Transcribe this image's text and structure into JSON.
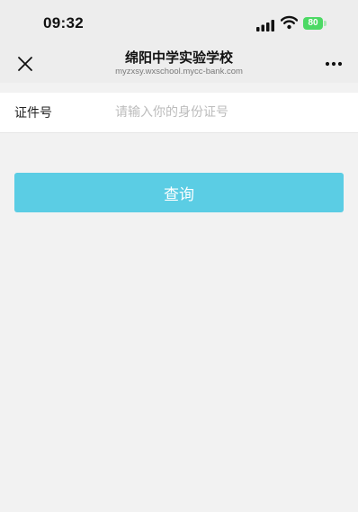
{
  "status_bar": {
    "time": "09:32",
    "battery": "80"
  },
  "nav": {
    "title": "绵阳中学实验学校",
    "subtitle": "myzxsy.wxschool.mycc-bank.com",
    "close_icon": "close-icon",
    "more_icon": "more-icon"
  },
  "form": {
    "id_label": "证件号",
    "id_value": "",
    "id_placeholder": "请输入你的身份证号"
  },
  "actions": {
    "query_label": "查询"
  },
  "colors": {
    "accent": "#5bcde4",
    "background": "#f2f2f2",
    "battery": "#4cd964"
  }
}
